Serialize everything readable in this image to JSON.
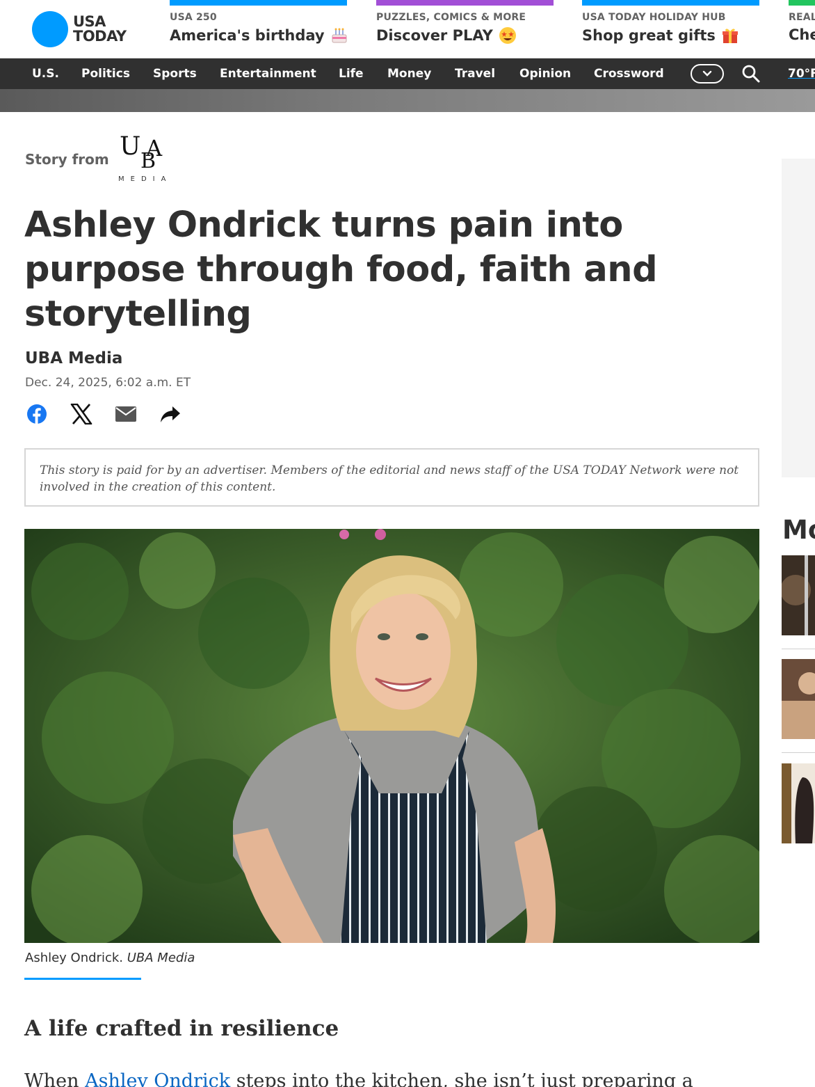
{
  "brand": {
    "line1": "USA",
    "line2": "TODAY",
    "accent": "#009bff"
  },
  "promos": [
    {
      "kicker": "USA 250",
      "headline": "America's birthday",
      "emoji": "cake-icon",
      "color": "#009bff"
    },
    {
      "kicker": "PUZZLES, COMICS & MORE",
      "headline": "Discover PLAY",
      "emoji": "star-struck-icon",
      "color": "#a24fd6"
    },
    {
      "kicker": "USA TODAY HOLIDAY HUB",
      "headline": "Shop great gifts",
      "emoji": "gift-icon",
      "color": "#009bff"
    },
    {
      "kicker": "REAL",
      "headline": "Che",
      "color": "#22c55e"
    }
  ],
  "nav": {
    "items": [
      "U.S.",
      "Politics",
      "Sports",
      "Entertainment",
      "Life",
      "Money",
      "Travel",
      "Opinion",
      "Crossword"
    ],
    "weather": "70°F"
  },
  "sponsor": {
    "label": "Story from",
    "logo_text": "UBA",
    "logo_sub": "MEDIA"
  },
  "article": {
    "title": "Ashley Ondrick turns pain into purpose through food, faith and storytelling",
    "author": "UBA Media",
    "date": "Dec. 24, 2025, 6:02 a.m. ET",
    "share": [
      "facebook-icon",
      "x-icon",
      "email-icon",
      "share-icon"
    ],
    "disclaimer": "This story is paid for by an advertiser. Members of the editorial and news staff of the USA TODAY Network were not involved in the creation of this content.",
    "photo": {
      "caption_name": "Ashley Ondrick.",
      "caption_credit": "UBA Media"
    },
    "subhead": "A life crafted in resilience",
    "body_prefix": "When ",
    "body_link": "Ashley Ondrick",
    "body_rest": " steps into the kitchen, she isn’t just preparing a"
  },
  "rail": {
    "title": "Mo"
  }
}
